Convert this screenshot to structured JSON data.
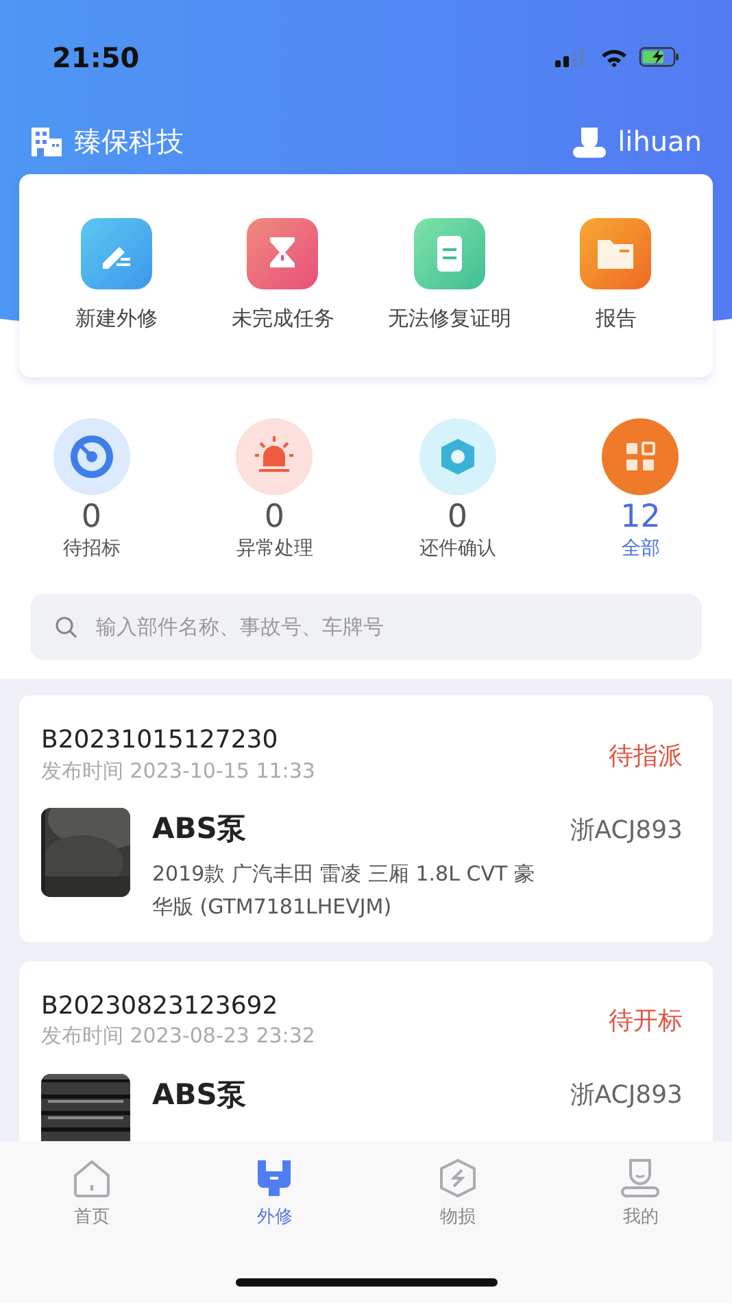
{
  "status_bar": {
    "time": "21:50"
  },
  "header": {
    "company": "臻保科技",
    "user": "lihuan"
  },
  "quick_actions": [
    {
      "label": "新建外修",
      "kind": "edit"
    },
    {
      "label": "未完成任务",
      "kind": "hourglass"
    },
    {
      "label": "无法修复证明",
      "kind": "document"
    },
    {
      "label": "报告",
      "kind": "folder"
    }
  ],
  "stats": [
    {
      "count": "0",
      "label": "待招标",
      "kind": "target",
      "selected": false
    },
    {
      "count": "0",
      "label": "异常处理",
      "kind": "alarm",
      "selected": false
    },
    {
      "count": "0",
      "label": "还件确认",
      "kind": "hex",
      "selected": false
    },
    {
      "count": "12",
      "label": "全部",
      "kind": "grid",
      "selected": true
    }
  ],
  "search": {
    "placeholder": "输入部件名称、事故号、车牌号"
  },
  "orders": [
    {
      "id": "B20231015127230",
      "published": "发布时间 2023-10-15 11:33",
      "status": "待指派",
      "part": "ABS泵",
      "plate": "浙ACJ893",
      "vehicle": "2019款 广汽丰田 雷凌 三厢 1.8L CVT 豪华版 (GTM7181LHEVJM)"
    },
    {
      "id": "B20230823123692",
      "published": "发布时间 2023-08-23 23:32",
      "status": "待开标",
      "part": "ABS泵",
      "plate": "浙ACJ893"
    }
  ],
  "tabs": [
    {
      "label": "首页",
      "kind": "home",
      "selected": false
    },
    {
      "label": "外修",
      "kind": "wrench",
      "selected": true
    },
    {
      "label": "物损",
      "kind": "shield",
      "selected": false
    },
    {
      "label": "我的",
      "kind": "user",
      "selected": false
    }
  ]
}
